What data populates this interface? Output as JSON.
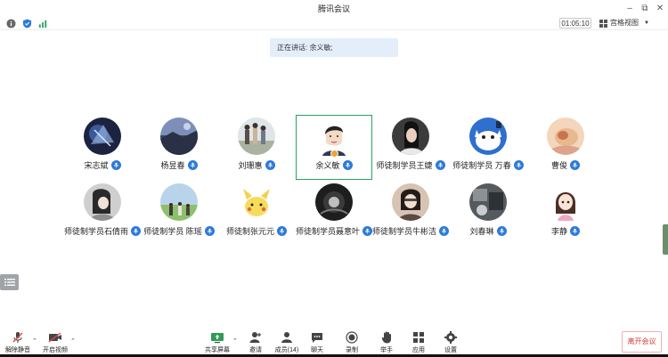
{
  "window": {
    "title": "腾讯会议"
  },
  "status": {
    "timer": "01:05:10",
    "view_mode": "宫格视图",
    "speaking_label": "正在讲话: 余义敏;"
  },
  "participants": [
    {
      "name": "宋志斌"
    },
    {
      "name": "杨昱春"
    },
    {
      "name": "刘珊惠"
    },
    {
      "name": "余义敏"
    },
    {
      "name": "师徒制学员王婕"
    },
    {
      "name": "师徒制学员 万春"
    },
    {
      "name": "曹俊"
    },
    {
      "name": "师徒制学员石倩雨"
    },
    {
      "name": "师徒制学员 陈瑶"
    },
    {
      "name": "师徒制张元元"
    },
    {
      "name": "师徒制学员聂意叶"
    },
    {
      "name": "师徒制学员牛彬洁"
    },
    {
      "name": "刘春琳"
    },
    {
      "name": "李静"
    }
  ],
  "toolbar": {
    "unmute": "解除静音",
    "start_video": "开启视频",
    "share_screen": "共享屏幕",
    "invite": "邀请",
    "members": "成员(14)",
    "chat": "聊天",
    "record": "录制",
    "raise_hand": "举手",
    "apps": "应用",
    "settings": "设置",
    "leave": "离开会议"
  },
  "colors": {
    "accent": "#2d7bd8",
    "speaker_border": "#27a35c",
    "leave": "#d43b3b"
  }
}
